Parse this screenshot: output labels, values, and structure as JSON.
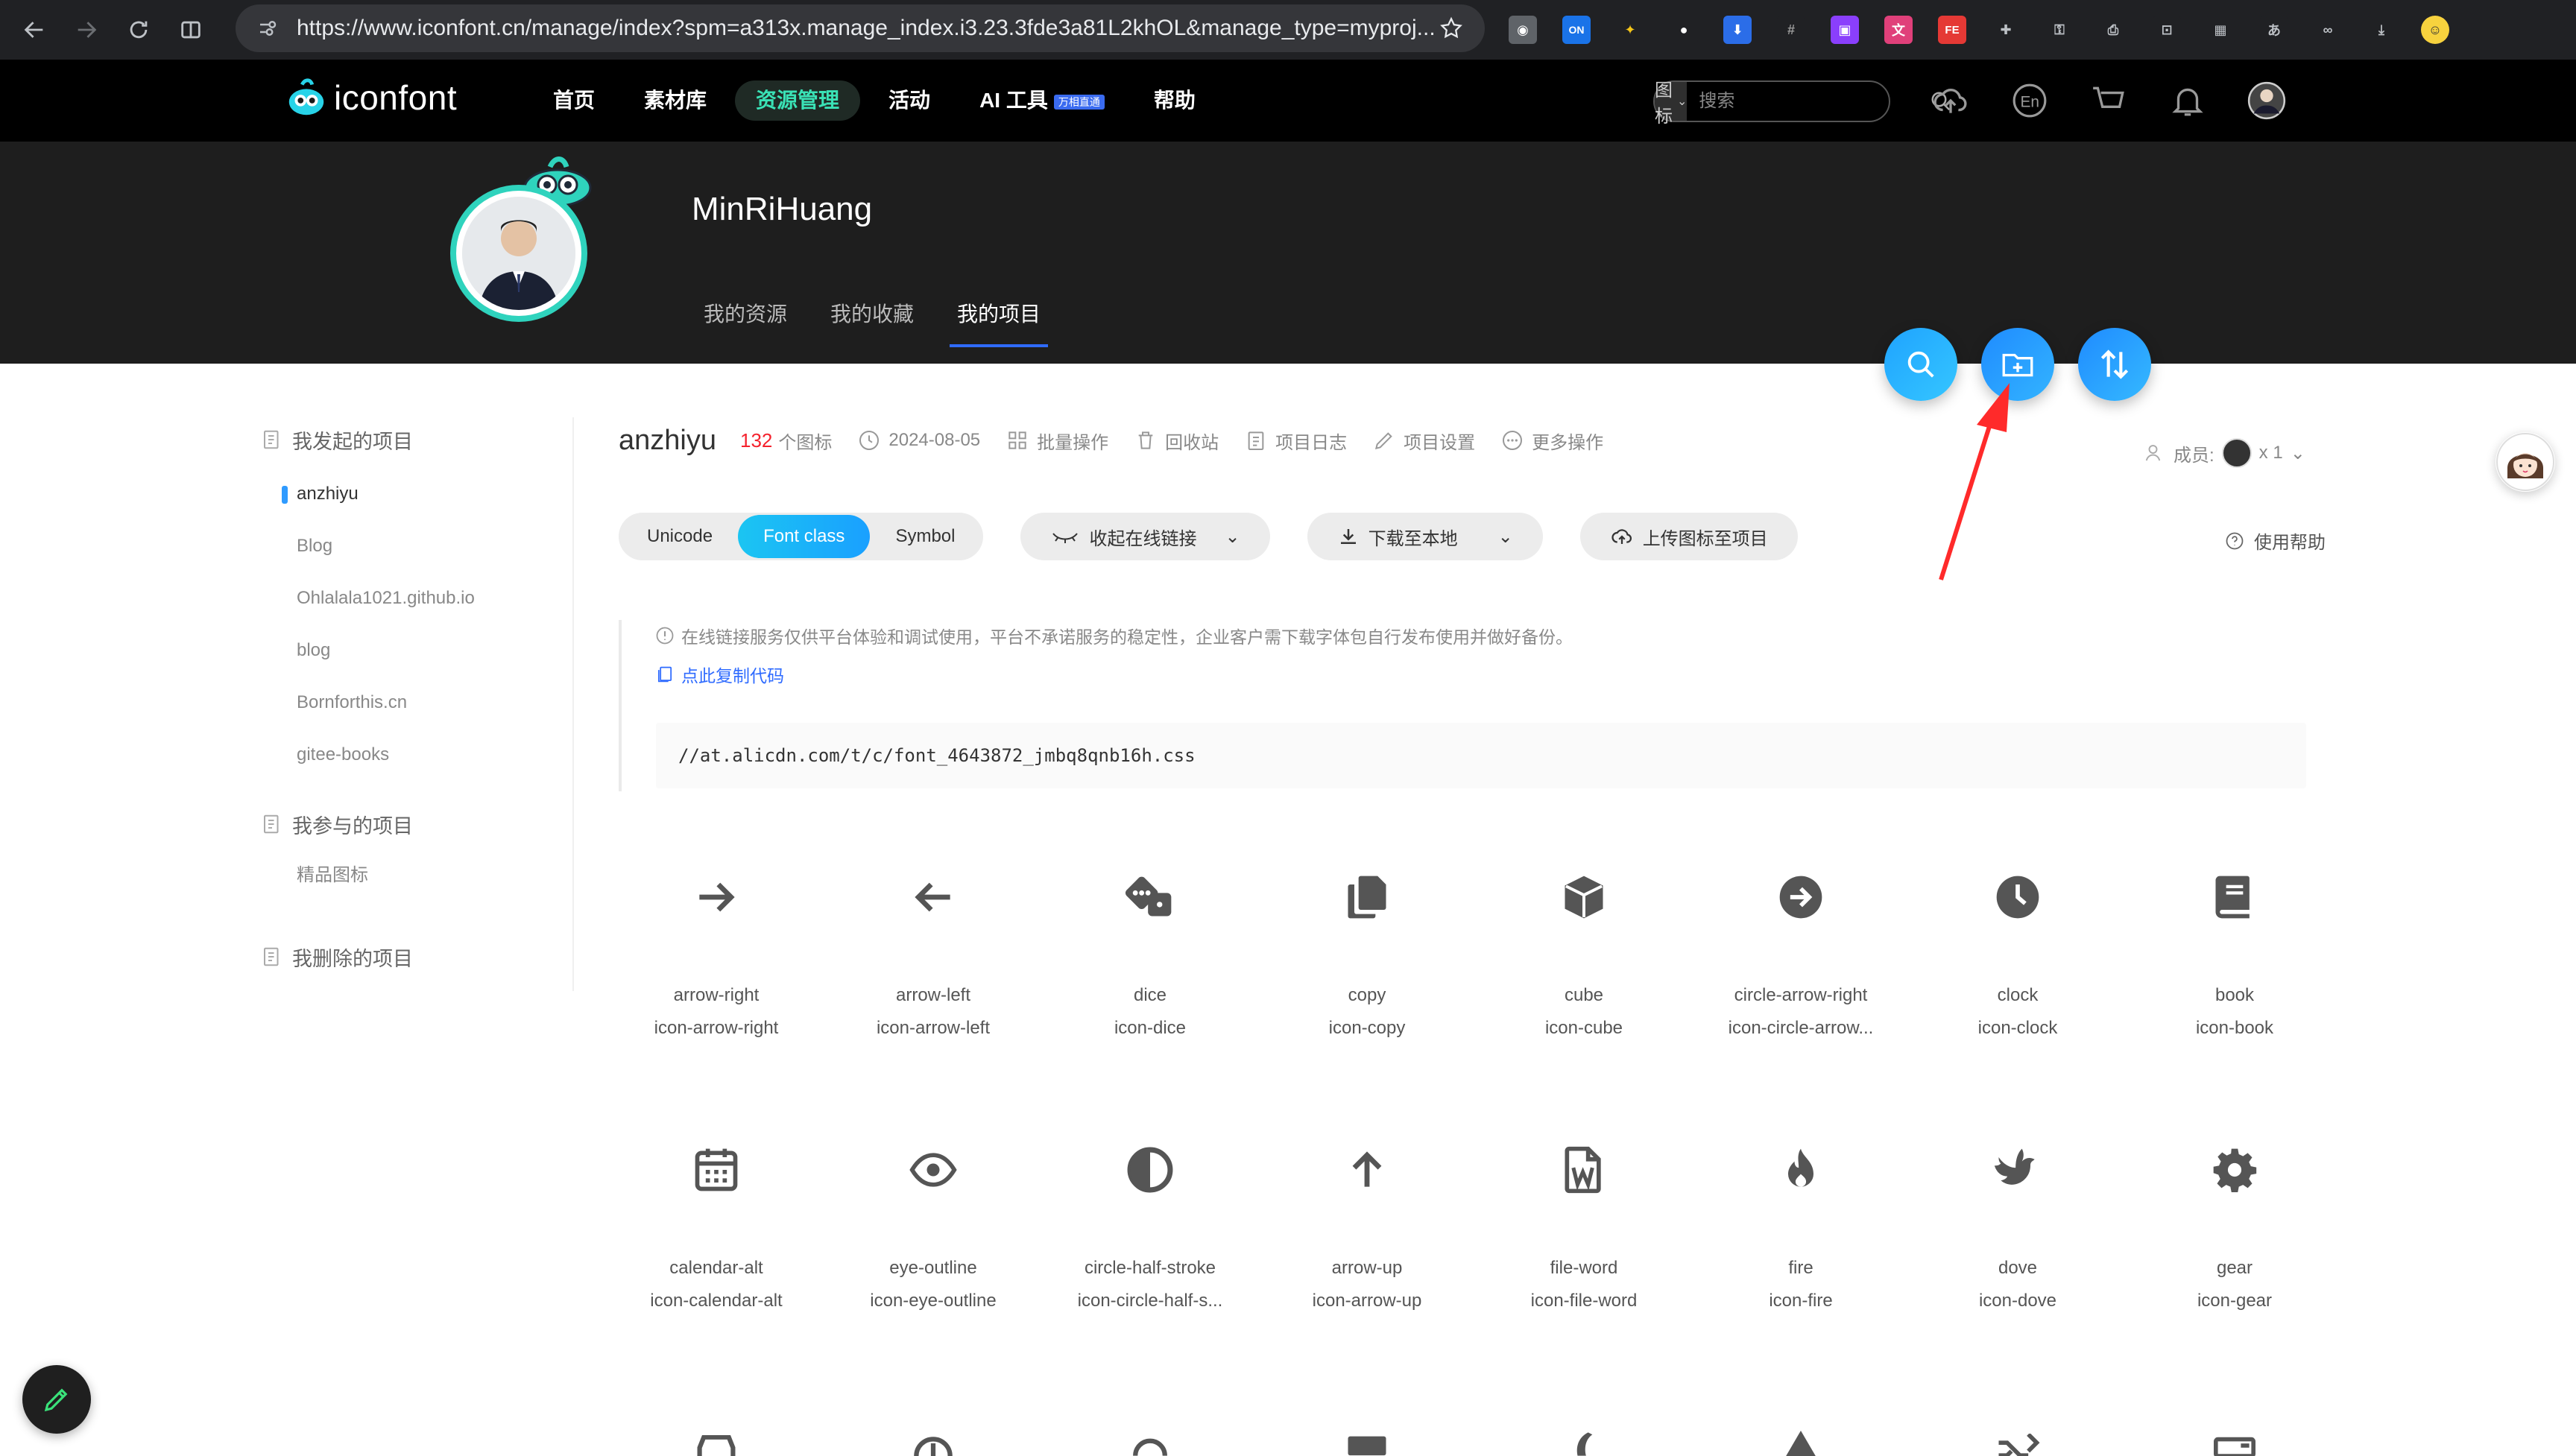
{
  "browser": {
    "url": "https://www.iconfont.cn/manage/index?spm=a313x.manage_index.i3.23.3fde3a81L2khOL&manage_type=myproj..."
  },
  "header": {
    "logo_text": "iconfont",
    "nav": [
      {
        "label": "首页"
      },
      {
        "label": "素材库"
      },
      {
        "label": "资源管理"
      },
      {
        "label": "活动"
      },
      {
        "label": "AI 工具",
        "badge": "万相直通"
      },
      {
        "label": "帮助"
      }
    ],
    "search_type": "图标",
    "search_placeholder": "搜索"
  },
  "profile": {
    "username": "MinRiHuang",
    "tabs": [
      "我的资源",
      "我的收藏",
      "我的项目"
    ]
  },
  "sidebar": {
    "groups": [
      {
        "label": "我发起的项目",
        "items": [
          "anzhiyu",
          "Blog",
          "Ohlalala1021.github.io",
          "blog",
          "Bornforthis.cn",
          "gitee-books"
        ]
      },
      {
        "label": "我参与的项目",
        "items": [
          "精品图标"
        ]
      },
      {
        "label": "我删除的项目",
        "items": []
      }
    ]
  },
  "project": {
    "name": "anzhiyu",
    "icon_count": "132",
    "icon_count_unit": "个图标",
    "date": "2024-08-05",
    "actions": [
      "批量操作",
      "回收站",
      "项目日志",
      "项目设置",
      "更多操作"
    ],
    "members_label": "成员:",
    "members_count": "x 1"
  },
  "toolbar": {
    "formats": [
      "Unicode",
      "Font class",
      "Symbol"
    ],
    "collapse_link": "收起在线链接",
    "download": "下载至本地",
    "upload": "上传图标至项目",
    "help": "使用帮助"
  },
  "notice": {
    "text": "在线链接服务仅供平台体验和调试使用，平台不承诺服务的稳定性，企业客户需下载字体包自行发布使用并做好备份。",
    "copy_label": "点此复制代码",
    "code": "//at.alicdn.com/t/c/font_4643872_jmbq8qnb16h.css"
  },
  "icons": [
    {
      "name": "arrow-right",
      "class": "icon-arrow-right",
      "glyph": "arrow-right-icon"
    },
    {
      "name": "arrow-left",
      "class": "icon-arrow-left",
      "glyph": "arrow-left-icon"
    },
    {
      "name": "dice",
      "class": "icon-dice",
      "glyph": "dice-icon"
    },
    {
      "name": "copy",
      "class": "icon-copy",
      "glyph": "copy-icon"
    },
    {
      "name": "cube",
      "class": "icon-cube",
      "glyph": "cube-icon"
    },
    {
      "name": "circle-arrow-right",
      "class": "icon-circle-arrow...",
      "glyph": "circle-arrow-right-icon"
    },
    {
      "name": "clock",
      "class": "icon-clock",
      "glyph": "clock-icon"
    },
    {
      "name": "book",
      "class": "icon-book",
      "glyph": "book-icon"
    },
    {
      "name": "calendar-alt",
      "class": "icon-calendar-alt",
      "glyph": "calendar-icon"
    },
    {
      "name": "eye-outline",
      "class": "icon-eye-outline",
      "glyph": "eye-icon"
    },
    {
      "name": "circle-half-stroke",
      "class": "icon-circle-half-s...",
      "glyph": "circle-half-icon"
    },
    {
      "name": "arrow-up",
      "class": "icon-arrow-up",
      "glyph": "arrow-up-icon"
    },
    {
      "name": "file-word",
      "class": "icon-file-word",
      "glyph": "file-word-icon"
    },
    {
      "name": "fire",
      "class": "icon-fire",
      "glyph": "fire-icon"
    },
    {
      "name": "dove",
      "class": "icon-dove",
      "glyph": "dove-icon"
    },
    {
      "name": "gear",
      "class": "icon-gear",
      "glyph": "gear-icon"
    }
  ],
  "colors": {
    "accent_teal": "#3ae2b6",
    "accent_blue": "#2f6bff",
    "count_red": "#f5222d",
    "annotation_red": "#ff2a2a"
  }
}
